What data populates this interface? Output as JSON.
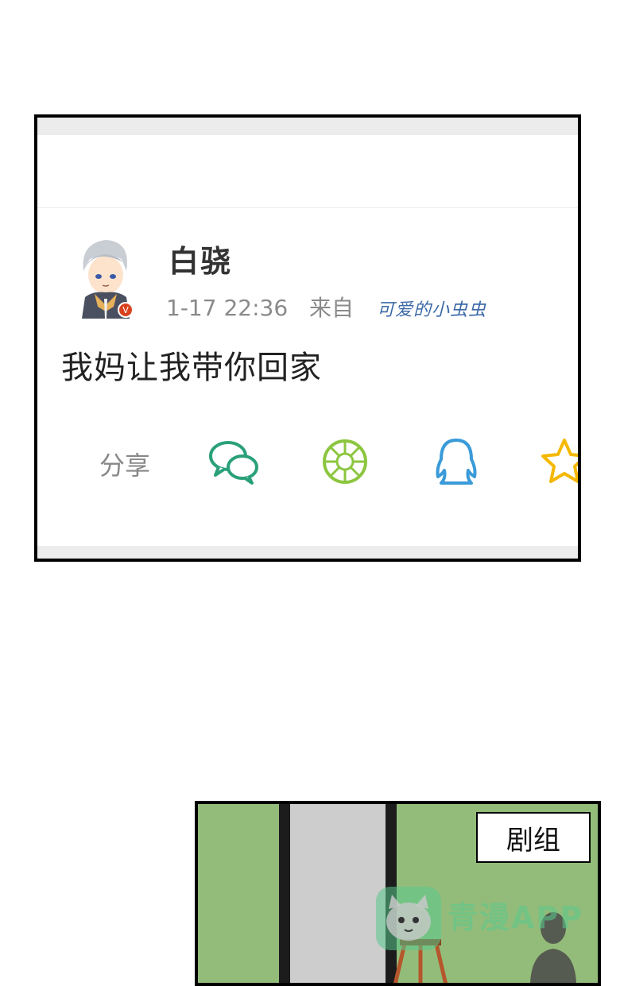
{
  "post": {
    "username": "白骁",
    "timestamp": "1-17 22:36",
    "from_label": "来自",
    "source": "可爱的小虫虫",
    "text": "我妈让我带你回家"
  },
  "share": {
    "label": "分享",
    "icons": [
      "wechat-icon",
      "moments-icon",
      "qq-icon",
      "qzone-star-icon"
    ]
  },
  "panel2": {
    "caption": "剧组"
  },
  "watermark": {
    "text": "青漫APP"
  }
}
